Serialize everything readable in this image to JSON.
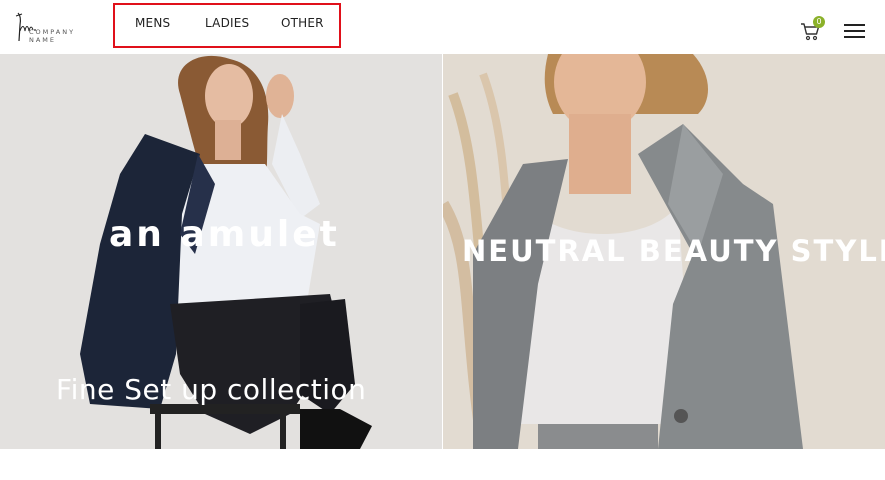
{
  "header": {
    "logo": {
      "line1": "COMPANY",
      "line2": "NAME"
    },
    "nav": [
      {
        "label": "MENS"
      },
      {
        "label": "LADIES"
      },
      {
        "label": "OTHER"
      }
    ],
    "cart": {
      "count": "0",
      "badge_color": "#8bb12a"
    },
    "highlight_color": "#e0101a"
  },
  "hero": {
    "left": {
      "title": "an amulet",
      "subtitle": "Fine Set up collection"
    },
    "right": {
      "title": "NEUTRAL BEAUTY STYLE"
    }
  }
}
